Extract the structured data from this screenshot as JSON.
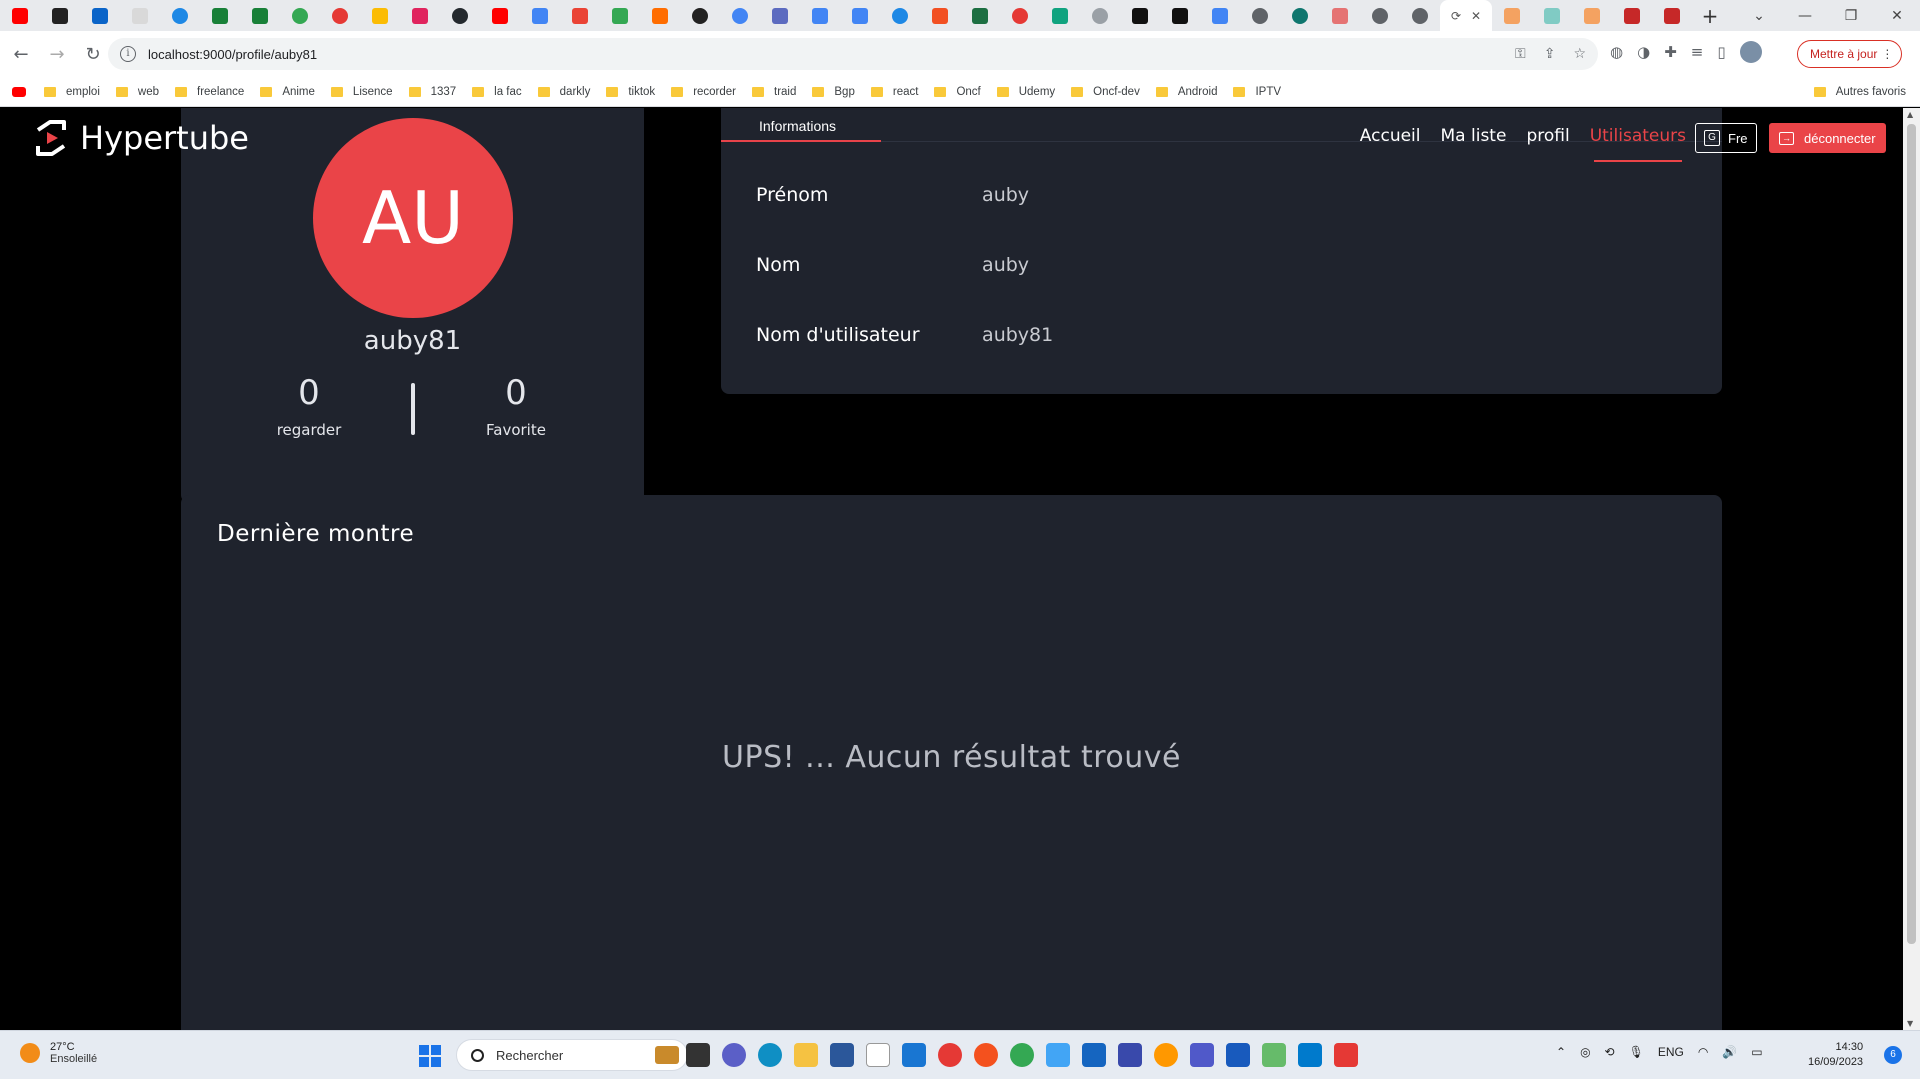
{
  "browser": {
    "url": "localhost:9000/profile/auby81",
    "update_button": "Mettre à jour",
    "bookmarks": [
      "emploi",
      "web",
      "freelance",
      "Anime",
      "Lisence",
      "1337",
      "la fac",
      "darkly",
      "tiktok",
      "recorder",
      "traid",
      "Bgp",
      "react",
      "Oncf",
      "Udemy",
      "Oncf-dev",
      "Android",
      "IPTV"
    ],
    "other_bookmarks": "Autres favoris"
  },
  "app": {
    "brand": "Hypertube",
    "nav": {
      "home": "Accueil",
      "my_list": "Ma liste",
      "profile": "profil",
      "users": "Utilisateurs"
    },
    "lang_button": "Fre",
    "logout_button": "déconnecter",
    "accent_color": "#ea4448"
  },
  "profile": {
    "initials": "AU",
    "username": "auby81",
    "stats": {
      "watched_count": "0",
      "watched_label": "regarder",
      "favorite_count": "0",
      "favorite_label": "Favorite"
    },
    "info_tab": "Informations",
    "fields": {
      "first_name_label": "Prénom",
      "first_name_value": "auby",
      "last_name_label": "Nom",
      "last_name_value": "auby",
      "username_label": "Nom d'utilisateur",
      "username_value": "auby81"
    }
  },
  "last_watched": {
    "title": "Dernière montre",
    "empty_message": "UPS! ... Aucun résultat trouvé"
  },
  "taskbar": {
    "temperature": "27°C",
    "weather": "Ensoleillé",
    "search_placeholder": "Rechercher",
    "language": "ENG",
    "time": "14:30",
    "date": "16/09/2023",
    "notification_count": "6"
  }
}
